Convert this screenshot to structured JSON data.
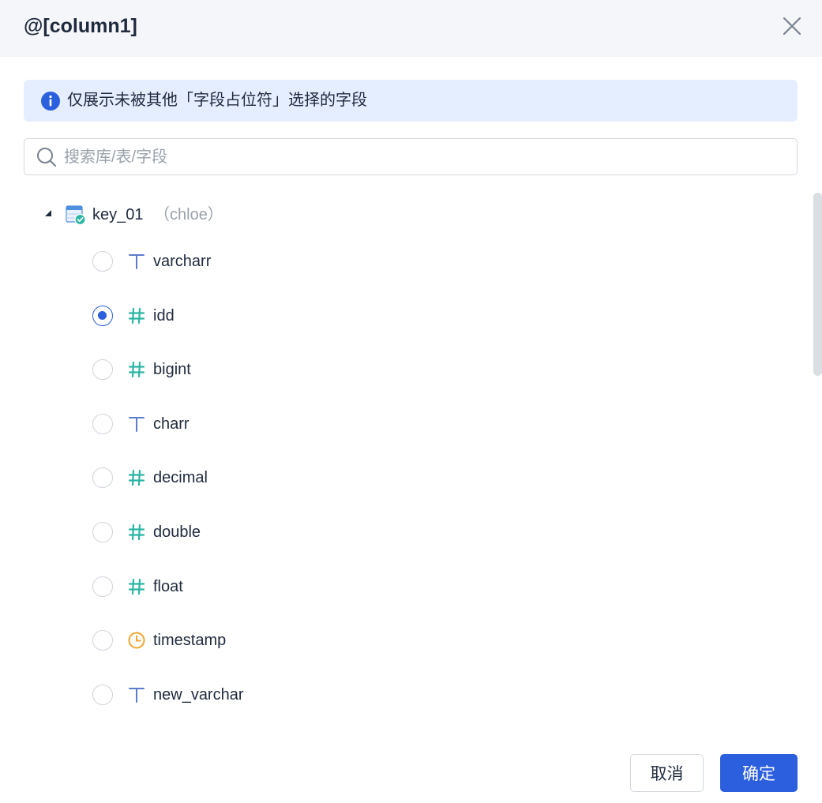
{
  "dialog": {
    "title": "@[column1]",
    "notice": "仅展示未被其他「字段占位符」选择的字段",
    "search": {
      "placeholder": "搜索库/表/字段",
      "value": ""
    },
    "tree": {
      "root": {
        "label": "key_01",
        "owner": "（chloe）",
        "icon": "table-check-icon",
        "expanded": true
      },
      "fields": [
        {
          "label": "varcharr",
          "type_icon": "text-type-icon",
          "checked": false
        },
        {
          "label": "idd",
          "type_icon": "number-type-icon",
          "checked": true
        },
        {
          "label": "bigint",
          "type_icon": "number-type-icon",
          "checked": false
        },
        {
          "label": "charr",
          "type_icon": "text-type-icon",
          "checked": false
        },
        {
          "label": "decimal",
          "type_icon": "number-type-icon",
          "checked": false
        },
        {
          "label": "double",
          "type_icon": "number-type-icon",
          "checked": false
        },
        {
          "label": "float",
          "type_icon": "number-type-icon",
          "checked": false
        },
        {
          "label": "timestamp",
          "type_icon": "time-type-icon",
          "checked": false
        },
        {
          "label": "new_varchar",
          "type_icon": "text-type-icon",
          "checked": false
        }
      ]
    },
    "buttons": {
      "cancel": "取消",
      "ok": "确定"
    }
  },
  "colors": {
    "primary": "#2c5fdd",
    "number_type": "#2bb5a4",
    "text_type": "#5b7bcb",
    "time_type": "#efa52f",
    "notice_bg": "#e5eeff"
  }
}
